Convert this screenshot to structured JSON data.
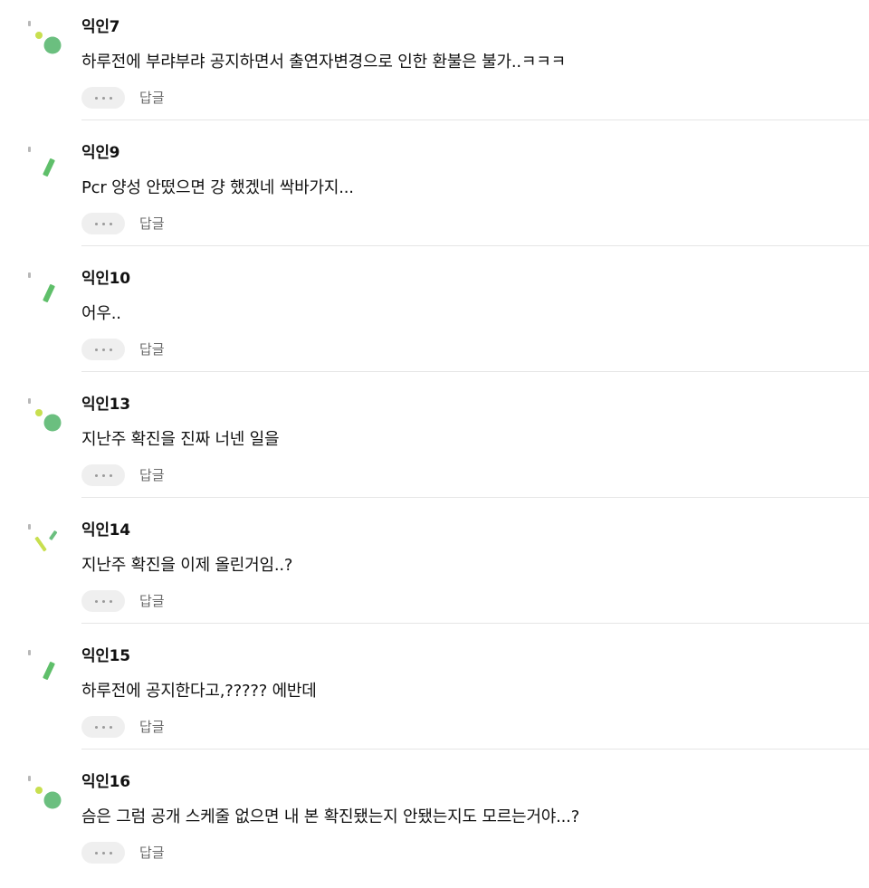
{
  "colors": {
    "avatar_green": "#6bbf7f",
    "avatar_stick_green": "#5fbf6a",
    "avatar_lime": "#c8df4f",
    "avatar_gray": "#b8b8b8",
    "divider": "#e6e6e6",
    "reply_text": "#6b6b6b"
  },
  "comments": [
    {
      "nickname": "익인7",
      "text": "하루전에 부랴부랴 공지하면서 출연자변경으로 인한 환불은 불가..ㅋㅋㅋ",
      "reply_label": "답글",
      "avatar_icon": "dots-circle-avatar-icon"
    },
    {
      "nickname": "익인9",
      "text": "Pcr 양성 안떴으면 걍 했겠네 싹바가지...",
      "reply_label": "답글",
      "avatar_icon": "green-stick-avatar-icon"
    },
    {
      "nickname": "익인10",
      "text": "어우..",
      "reply_label": "답글",
      "avatar_icon": "green-stick-avatar-icon"
    },
    {
      "nickname": "익인13",
      "text": "지난주 확진을 진짜 너넨 일을",
      "reply_label": "답글",
      "avatar_icon": "dots-circle-avatar-icon"
    },
    {
      "nickname": "익인14",
      "text": "지난주 확진을 이제 올린거임..?",
      "reply_label": "답글",
      "avatar_icon": "lime-sticks-avatar-icon"
    },
    {
      "nickname": "익인15",
      "text": "하루전에 공지한다고,????? 에반데",
      "reply_label": "답글",
      "avatar_icon": "green-stick-avatar-icon"
    },
    {
      "nickname": "익인16",
      "text": "슴은 그럼 공개 스케줄 없으면 내 본 확진됐는지 안됐는지도 모르는거야...?",
      "reply_label": "답글",
      "avatar_icon": "dots-circle-avatar-icon"
    }
  ]
}
